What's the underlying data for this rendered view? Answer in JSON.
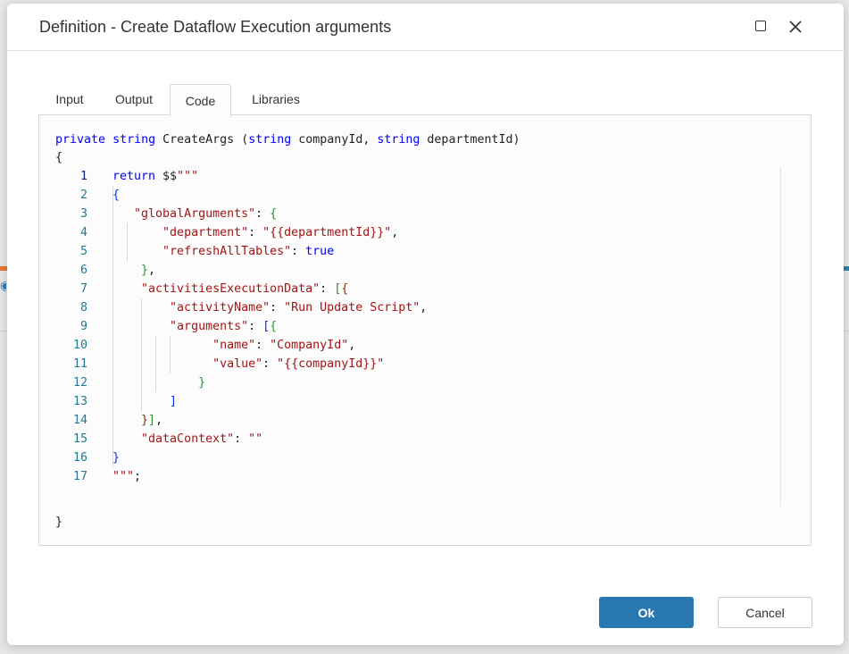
{
  "dialog": {
    "title": "Definition - Create Dataflow Execution arguments",
    "maximize_icon": "maximize-icon",
    "close_icon": "close-icon"
  },
  "tabs": [
    {
      "label": "Input",
      "active": false
    },
    {
      "label": "Output",
      "active": false
    },
    {
      "label": "Code",
      "active": true
    },
    {
      "label": "Libraries",
      "active": false
    }
  ],
  "code_panel": {
    "signature": {
      "kw1": "private",
      "kw2": "string",
      "name": "CreateArgs",
      "paren_open": "(",
      "p1_type": "string",
      "p1_name": "companyId,",
      "p2_type": "string",
      "p2_name": "departmentId)"
    },
    "open_brace": "{",
    "close_brace": "}",
    "lines": [
      {
        "n": "1",
        "segments": [
          {
            "t": "kw",
            "v": "return"
          },
          {
            "t": "tx",
            "v": " $$"
          },
          {
            "t": "str",
            "v": "\"\"\""
          }
        ]
      },
      {
        "n": "2",
        "segments": [
          {
            "t": "brace",
            "v": "{"
          }
        ]
      },
      {
        "n": "3",
        "segments": [
          {
            "t": "tx",
            "v": "   "
          },
          {
            "t": "str",
            "v": "\"globalArguments\""
          },
          {
            "t": "tx",
            "v": ": "
          },
          {
            "t": "brace2",
            "v": "{"
          }
        ]
      },
      {
        "n": "4",
        "segments": [
          {
            "t": "tx",
            "v": "       "
          },
          {
            "t": "str",
            "v": "\"department\""
          },
          {
            "t": "tx",
            "v": ": "
          },
          {
            "t": "str",
            "v": "\"{{departmentId}}\""
          },
          {
            "t": "tx",
            "v": ","
          }
        ]
      },
      {
        "n": "5",
        "segments": [
          {
            "t": "tx",
            "v": "       "
          },
          {
            "t": "str",
            "v": "\"refreshAllTables\""
          },
          {
            "t": "tx",
            "v": ": "
          },
          {
            "t": "kw",
            "v": "true"
          }
        ]
      },
      {
        "n": "6",
        "segments": [
          {
            "t": "tx",
            "v": "    "
          },
          {
            "t": "brace2",
            "v": "}"
          },
          {
            "t": "tx",
            "v": ","
          }
        ]
      },
      {
        "n": "7",
        "segments": [
          {
            "t": "tx",
            "v": "    "
          },
          {
            "t": "str",
            "v": "\"activitiesExecutionData\""
          },
          {
            "t": "tx",
            "v": ": "
          },
          {
            "t": "brace2",
            "v": "["
          },
          {
            "t": "brace3",
            "v": "{"
          }
        ]
      },
      {
        "n": "8",
        "segments": [
          {
            "t": "tx",
            "v": "        "
          },
          {
            "t": "str",
            "v": "\"activityName\""
          },
          {
            "t": "tx",
            "v": ": "
          },
          {
            "t": "str",
            "v": "\"Run Update Script\""
          },
          {
            "t": "tx",
            "v": ","
          }
        ]
      },
      {
        "n": "9",
        "segments": [
          {
            "t": "tx",
            "v": "        "
          },
          {
            "t": "str",
            "v": "\"arguments\""
          },
          {
            "t": "tx",
            "v": ": "
          },
          {
            "t": "brace",
            "v": "["
          },
          {
            "t": "brace2",
            "v": "{"
          }
        ]
      },
      {
        "n": "10",
        "segments": [
          {
            "t": "tx",
            "v": "              "
          },
          {
            "t": "str",
            "v": "\"name\""
          },
          {
            "t": "tx",
            "v": ": "
          },
          {
            "t": "str",
            "v": "\"CompanyId\""
          },
          {
            "t": "tx",
            "v": ","
          }
        ]
      },
      {
        "n": "11",
        "segments": [
          {
            "t": "tx",
            "v": "              "
          },
          {
            "t": "str",
            "v": "\"value\""
          },
          {
            "t": "tx",
            "v": ": "
          },
          {
            "t": "str",
            "v": "\"{{companyId}}\""
          }
        ]
      },
      {
        "n": "12",
        "segments": [
          {
            "t": "tx",
            "v": "            "
          },
          {
            "t": "brace2",
            "v": "}"
          }
        ]
      },
      {
        "n": "13",
        "segments": [
          {
            "t": "tx",
            "v": "        "
          },
          {
            "t": "brace",
            "v": "]"
          }
        ]
      },
      {
        "n": "14",
        "segments": [
          {
            "t": "tx",
            "v": "    "
          },
          {
            "t": "brace3",
            "v": "}"
          },
          {
            "t": "brace2",
            "v": "]"
          },
          {
            "t": "tx",
            "v": ","
          }
        ]
      },
      {
        "n": "15",
        "segments": [
          {
            "t": "tx",
            "v": "    "
          },
          {
            "t": "str",
            "v": "\"dataContext\""
          },
          {
            "t": "tx",
            "v": ": "
          },
          {
            "t": "str",
            "v": "\"\""
          }
        ]
      },
      {
        "n": "16",
        "segments": [
          {
            "t": "brace",
            "v": "}"
          }
        ]
      },
      {
        "n": "17",
        "segments": [
          {
            "t": "str",
            "v": "\"\"\""
          },
          {
            "t": "tx",
            "v": ";"
          }
        ]
      }
    ]
  },
  "footer": {
    "ok_label": "Ok",
    "cancel_label": "Cancel"
  },
  "colors": {
    "primary": "#2a78b2",
    "keyword": "#0000ff",
    "string": "#a31515",
    "line_number": "#237893"
  }
}
